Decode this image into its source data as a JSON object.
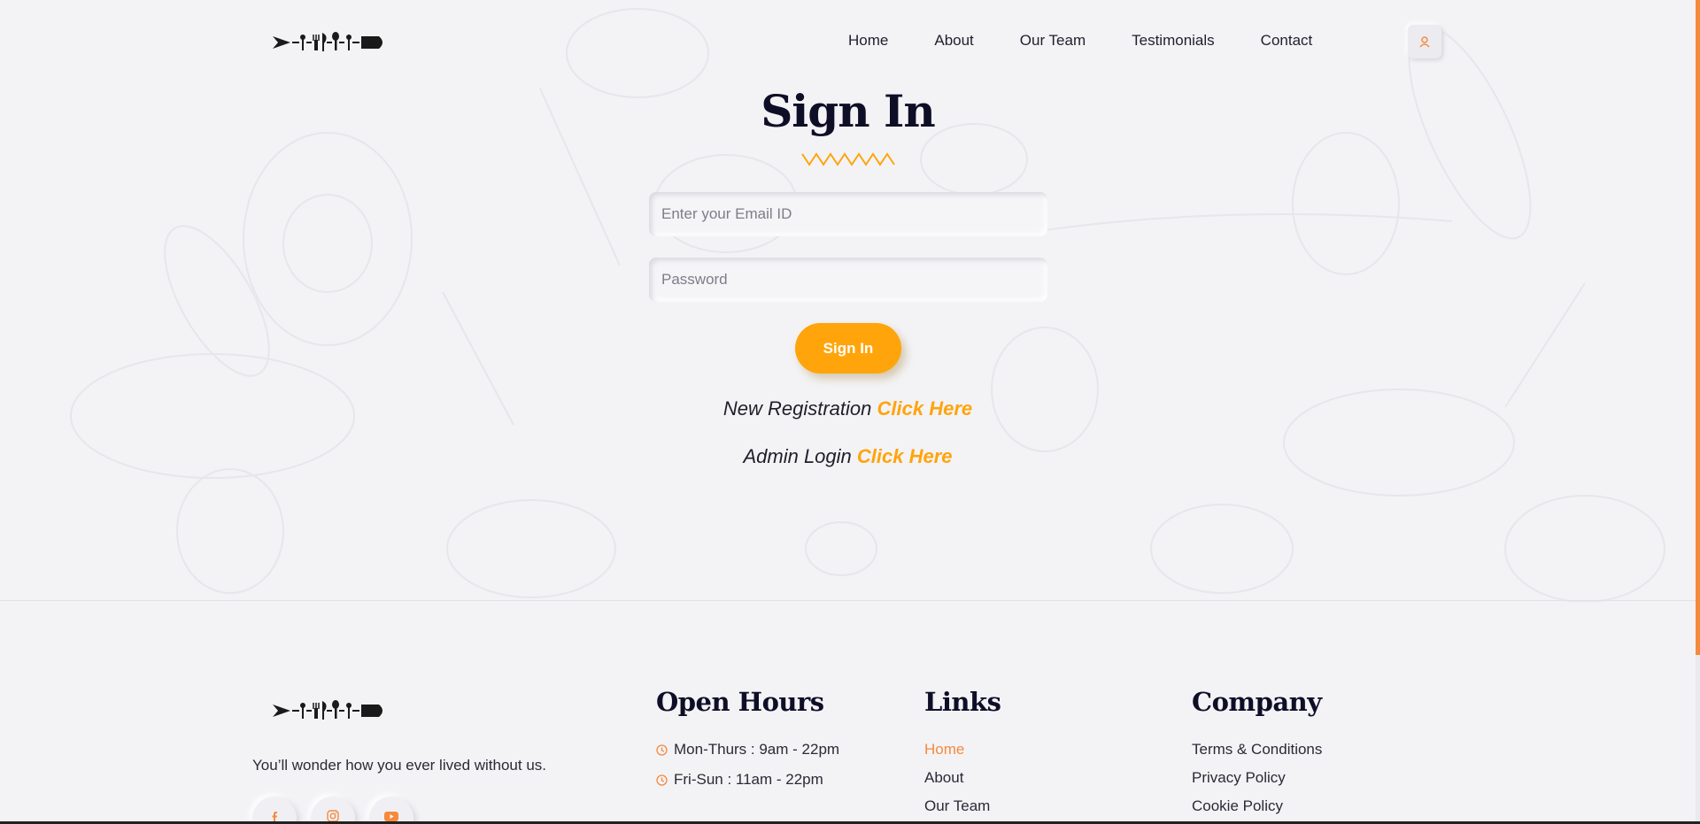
{
  "nav": {
    "items": [
      {
        "label": "Home"
      },
      {
        "label": "About"
      },
      {
        "label": "Our Team"
      },
      {
        "label": "Testimonials"
      },
      {
        "label": "Contact"
      }
    ],
    "user_icon": "user-icon"
  },
  "signin": {
    "title": "Sign In",
    "email_placeholder": "Enter your Email ID",
    "password_placeholder": "Password",
    "button_label": "Sign In",
    "registration_text": "New Registration",
    "registration_link": "Click Here",
    "admin_text": "Admin Login",
    "admin_link": "Click Here"
  },
  "footer": {
    "tagline": "You’ll wonder how you ever lived without us.",
    "socials": [
      {
        "icon": "facebook-icon"
      },
      {
        "icon": "instagram-icon"
      },
      {
        "icon": "youtube-icon"
      }
    ],
    "open_hours": {
      "title": "Open Hours",
      "items": [
        "Mon-Thurs : 9am - 22pm",
        "Fri-Sun : 11am - 22pm"
      ]
    },
    "links": {
      "title": "Links",
      "items": [
        "Home",
        "About",
        "Our Team"
      ]
    },
    "company": {
      "title": "Company",
      "items": [
        "Terms & Conditions",
        "Privacy Policy",
        "Cookie Policy"
      ]
    }
  },
  "colors": {
    "accent": "#ffa40a",
    "accent_orange": "#f58a3d",
    "heading": "#0f0e27",
    "background": "#f3f3f6"
  }
}
